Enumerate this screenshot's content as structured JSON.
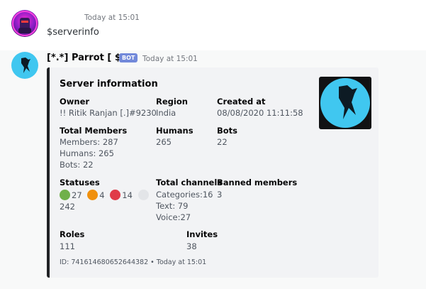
{
  "message1": {
    "timestamp": "Today at 15:01",
    "text": "$serverinfo"
  },
  "message2": {
    "author": "[*.*] Parrot [ $ ]",
    "badge": "BOT",
    "timestamp": "Today at 15:01",
    "embed": {
      "title": "Server information",
      "owner": {
        "name": "Owner",
        "value": "!! Ritik Ranjan [.]#9230"
      },
      "region": {
        "name": "Region",
        "value": "India"
      },
      "created": {
        "name": "Created at",
        "value": "08/08/2020 11:11:58"
      },
      "total_members": {
        "name": "Total Members",
        "lines": [
          "Members: 287",
          "Humans: 265",
          "Bots: 22"
        ]
      },
      "humans": {
        "name": "Humans",
        "value": "265"
      },
      "bots": {
        "name": "Bots",
        "value": "22"
      },
      "statuses": {
        "name": "Statuses",
        "items": [
          {
            "color": "#70b04a",
            "count": "27"
          },
          {
            "color": "#f0900e",
            "count": "4"
          },
          {
            "color": "#e03b48",
            "count": "14"
          },
          {
            "color": "#e3e5e8",
            "count": "242"
          }
        ]
      },
      "channels": {
        "name": "Total channels",
        "lines": [
          "Categories:16",
          "Text: 79",
          "Voice:27"
        ]
      },
      "banned": {
        "name": "Banned members",
        "value": "3"
      },
      "roles": {
        "name": "Roles",
        "value": "111"
      },
      "invites": {
        "name": "Invites",
        "value": "38"
      },
      "footer": "ID: 741614680652644382 • Today at 15:01"
    }
  }
}
